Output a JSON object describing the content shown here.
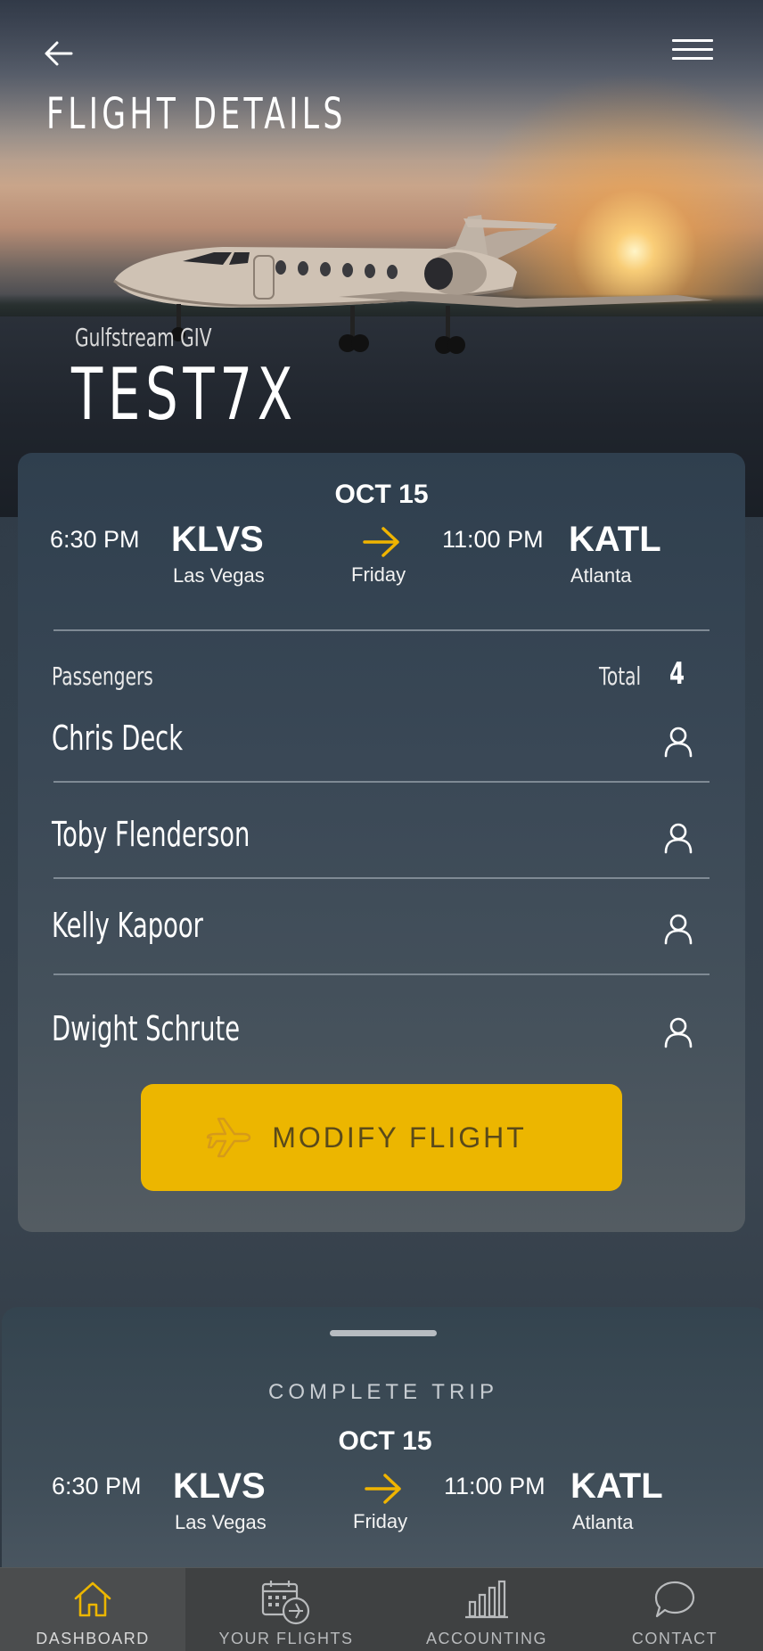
{
  "header": {
    "title": "FLIGHT DETAILS",
    "back_icon": "arrow-left-icon",
    "menu_icon": "hamburger-menu-icon"
  },
  "aircraft": {
    "model": "Gulfstream GIV",
    "tail_number": "TEST7X"
  },
  "flight": {
    "date": "OCT 15",
    "day": "Friday",
    "departure": {
      "time": "6:30 PM",
      "code": "KLVS",
      "city": "Las Vegas"
    },
    "arrival": {
      "time": "11:00 PM",
      "code": "KATL",
      "city": "Atlanta"
    }
  },
  "passengers": {
    "label": "Passengers",
    "total_label": "Total",
    "total": "4",
    "list": [
      {
        "name": "Chris Deck"
      },
      {
        "name": "Toby Flenderson"
      },
      {
        "name": "Kelly Kapoor"
      },
      {
        "name": "Dwight Schrute"
      }
    ]
  },
  "modify_button": {
    "label": "MODIFY FLIGHT",
    "icon": "airplane-icon"
  },
  "complete_trip": {
    "title": "COMPLETE TRIP",
    "date": "OCT 15",
    "day": "Friday",
    "departure": {
      "time": "6:30 PM",
      "code": "KLVS",
      "city": "Las Vegas"
    },
    "arrival": {
      "time": "11:00 PM",
      "code": "KATL",
      "city": "Atlanta"
    }
  },
  "bottom_nav": {
    "items": [
      {
        "label": "DASHBOARD",
        "icon": "home-icon",
        "active": true
      },
      {
        "label": "YOUR FLIGHTS",
        "icon": "calendar-plane-icon",
        "active": false
      },
      {
        "label": "ACCOUNTING",
        "icon": "bar-chart-icon",
        "active": false
      },
      {
        "label": "CONTACT",
        "icon": "chat-bubble-icon",
        "active": false
      }
    ]
  },
  "colors": {
    "accent": "#ecb600",
    "arrow": "#f0b400",
    "card": "#3a4856",
    "nav_bg": "#3f4142"
  }
}
